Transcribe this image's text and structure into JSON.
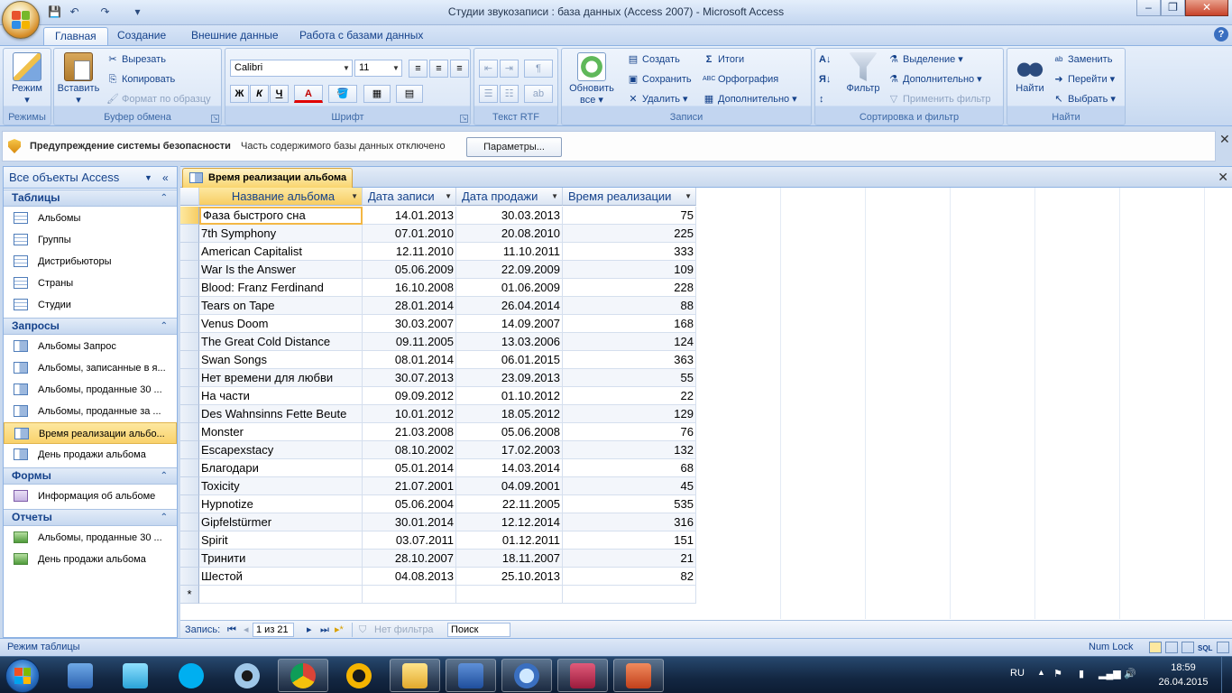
{
  "window": {
    "title": "Студии звукозаписи : база данных (Access 2007) - Microsoft Access"
  },
  "qat": {
    "save": "💾",
    "undo": "↶",
    "redo": "↷",
    "customize": "▾"
  },
  "tabs": [
    {
      "label": "Главная"
    },
    {
      "label": "Создание"
    },
    {
      "label": "Внешние данные"
    },
    {
      "label": "Работа с базами данных"
    }
  ],
  "ribbon": {
    "groups": {
      "views": "Режимы",
      "clipboard": "Буфер обмена",
      "font": "Шрифт",
      "rtf": "Текст RTF",
      "records": "Записи",
      "sort": "Сортировка и фильтр",
      "find": "Найти"
    },
    "views": {
      "mode": "Режим"
    },
    "clipboard": {
      "paste": "Вставить",
      "cut": "Вырезать",
      "copy": "Копировать",
      "format_painter": "Формат по образцу"
    },
    "font": {
      "name": "Calibri",
      "size": "11",
      "bold": "Ж",
      "italic": "К",
      "underline": "Ч",
      "font_color": "A"
    },
    "records": {
      "refresh": "Обновить",
      "refresh2": "все ▾",
      "new": "Создать",
      "save": "Сохранить",
      "delete": "Удалить",
      "totals": "Итоги",
      "spelling": "Орфография",
      "more": "Дополнительно"
    },
    "sort": {
      "filter": "Фильтр",
      "selection": "Выделение",
      "advanced": "Дополнительно",
      "toggle_filter": "Применить фильтр"
    },
    "find": {
      "find": "Найти",
      "replace": "Заменить",
      "goto": "Перейти",
      "select": "Выбрать"
    }
  },
  "security": {
    "title": "Предупреждение системы безопасности",
    "message": "Часть содержимого базы данных отключено",
    "button": "Параметры..."
  },
  "nav": {
    "header": "Все объекты Access",
    "sections": [
      {
        "title": "Таблицы",
        "type": "table",
        "items": [
          "Альбомы",
          "Группы",
          "Дистрибьюторы",
          "Страны",
          "Студии"
        ]
      },
      {
        "title": "Запросы",
        "type": "query",
        "items": [
          "Альбомы Запрос",
          "Альбомы, записанные в я...",
          "Альбомы, проданные 30 ...",
          "Альбомы, проданные за ...",
          "Время реализации альбо...",
          "День продажи альбома"
        ]
      },
      {
        "title": "Формы",
        "type": "form",
        "items": [
          "Информация об альбоме"
        ]
      },
      {
        "title": "Отчеты",
        "type": "report",
        "items": [
          "Альбомы, проданные 30 ...",
          "День продажи альбома"
        ]
      }
    ],
    "selected": "Время реализации альбо..."
  },
  "doc": {
    "tab_title": "Время реализации альбома"
  },
  "grid": {
    "columns": [
      "Название альбома",
      "Дата записи",
      "Дата продажи",
      "Время реализации"
    ],
    "rows": [
      [
        "Фаза быстрого сна",
        "14.01.2013",
        "30.03.2013",
        "75"
      ],
      [
        "7th Symphony",
        "07.01.2010",
        "20.08.2010",
        "225"
      ],
      [
        "American Capitalist",
        "12.11.2010",
        "11.10.2011",
        "333"
      ],
      [
        "War Is the Answer",
        "05.06.2009",
        "22.09.2009",
        "109"
      ],
      [
        "Blood: Franz Ferdinand",
        "16.10.2008",
        "01.06.2009",
        "228"
      ],
      [
        "Tears on Tape",
        "28.01.2014",
        "26.04.2014",
        "88"
      ],
      [
        "Venus Doom",
        "30.03.2007",
        "14.09.2007",
        "168"
      ],
      [
        "The Great Cold Distance",
        "09.11.2005",
        "13.03.2006",
        "124"
      ],
      [
        "Swan Songs",
        "08.01.2014",
        "06.01.2015",
        "363"
      ],
      [
        "Нет времени для любви",
        "30.07.2013",
        "23.09.2013",
        "55"
      ],
      [
        "На части",
        "09.09.2012",
        "01.10.2012",
        "22"
      ],
      [
        "Des Wahnsinns Fette Beute",
        "10.01.2012",
        "18.05.2012",
        "129"
      ],
      [
        "Monster",
        "21.03.2008",
        "05.06.2008",
        "76"
      ],
      [
        "Escapexstacy",
        "08.10.2002",
        "17.02.2003",
        "132"
      ],
      [
        "Благодари",
        "05.01.2014",
        "14.03.2014",
        "68"
      ],
      [
        "Toxicity",
        "21.07.2001",
        "04.09.2001",
        "45"
      ],
      [
        "Hypnotize",
        "05.06.2004",
        "22.11.2005",
        "535"
      ],
      [
        "Gipfelstürmer",
        "30.01.2014",
        "12.12.2014",
        "316"
      ],
      [
        "Spirit",
        "03.07.2011",
        "01.12.2011",
        "151"
      ],
      [
        "Тринити",
        "28.10.2007",
        "18.11.2007",
        "21"
      ],
      [
        "Шестой",
        "04.08.2013",
        "25.10.2013",
        "82"
      ]
    ],
    "new_row_marker": "*"
  },
  "recnav": {
    "label": "Запись:",
    "position": "1 из 21",
    "filter": "Нет фильтра",
    "search_placeholder": "Поиск"
  },
  "status": {
    "left": "Режим таблицы",
    "numlock": "Num Lock"
  },
  "tray": {
    "lang": "RU",
    "time": "18:59",
    "date": "26.04.2015"
  }
}
